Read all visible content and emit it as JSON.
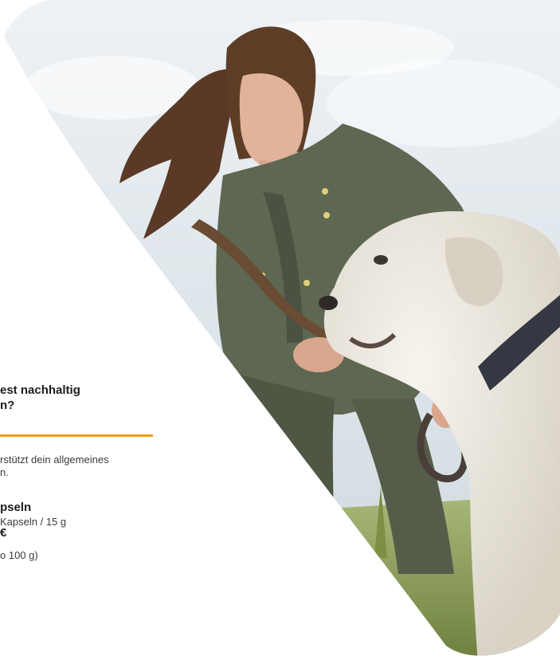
{
  "promo": {
    "headline_line1": "est nachhaltig",
    "headline_line2": "n?",
    "body_line1": "rstützt dein allgemeines",
    "body_line2": "n.",
    "product_name": "pseln",
    "product_detail": "Kapseln / 15 g",
    "price": "€",
    "unit_price": "o 100 g)"
  },
  "colors": {
    "accent": "#f39c12",
    "text": "#1d1d1b",
    "sky": "#dfe7ee",
    "jacket": "#5d6650",
    "dog": "#ece8df",
    "grass": "#8fa35a"
  }
}
